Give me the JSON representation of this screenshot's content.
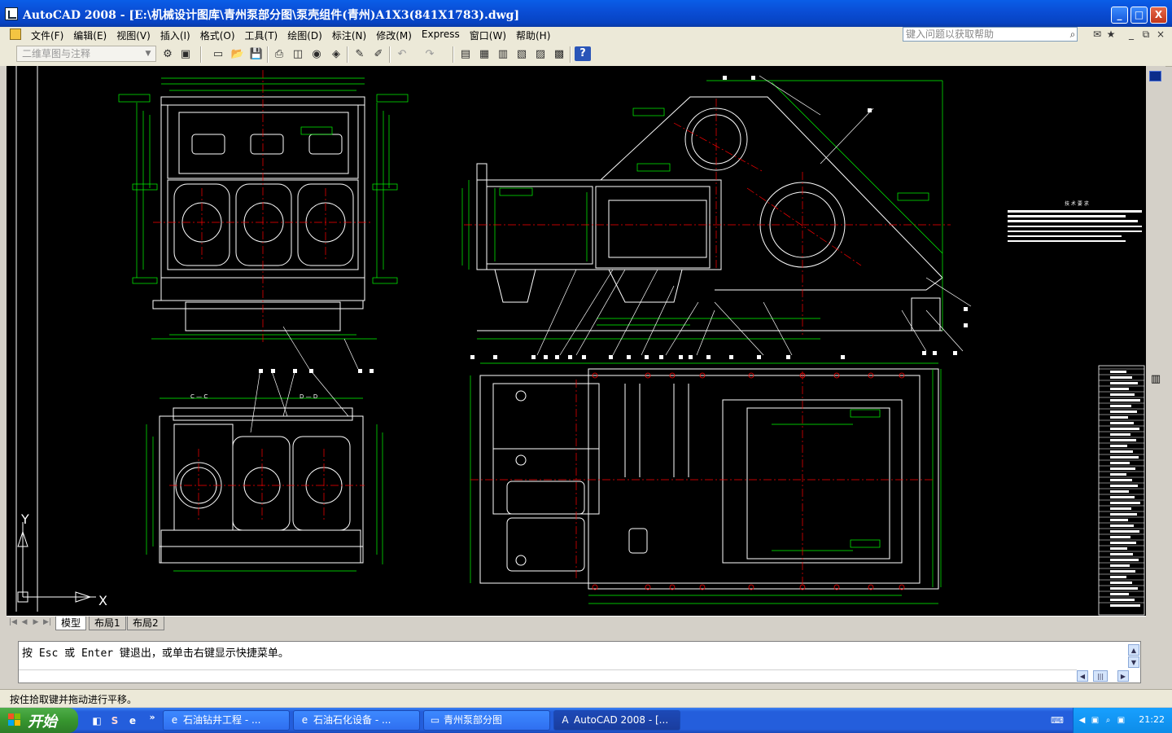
{
  "window": {
    "title": "AutoCAD 2008 - [E:\\机械设计图库\\青州泵部分图\\泵壳组件(青州)A1X3(841X1783).dwg]",
    "min_label": "_",
    "max_label": "□",
    "close_label": "X"
  },
  "menubar": {
    "items": [
      "文件(F)",
      "编辑(E)",
      "视图(V)",
      "插入(I)",
      "格式(O)",
      "工具(T)",
      "绘图(D)",
      "标注(N)",
      "修改(M)",
      "Express",
      "窗口(W)",
      "帮助(H)"
    ],
    "help_placeholder": "键入问题以获取帮助",
    "doc_min": "_",
    "doc_restore": "⧉",
    "doc_close": "×"
  },
  "toolbar": {
    "workspace": "二维草图与注释",
    "icons": [
      "gear-icon",
      "toolpalette-icon",
      "new-icon",
      "open-icon",
      "save-icon",
      "print-icon",
      "preview-icon",
      "publish-icon",
      "plot3d-icon",
      "brush-icon",
      "matchprop-icon",
      "undo-icon",
      "redo-icon",
      "layers-icon",
      "properties-icon",
      "designcenter-icon",
      "sheetset-icon",
      "markup-icon",
      "calculator-icon",
      "help-icon"
    ]
  },
  "drawing": {
    "background": "#000000",
    "ucs_x": "X",
    "ucs_y": "Y",
    "tech_req_title": "技 术 要 求",
    "section_cc": "C — C",
    "section_dd": "D — D"
  },
  "tabs": {
    "items": [
      "模型",
      "布局1",
      "布局2"
    ],
    "active": "模型"
  },
  "command": {
    "text": "按 Esc 或 Enter 键退出，或单击右键显示快捷菜单。"
  },
  "status": {
    "text": "按住拾取键并拖动进行平移。"
  },
  "taskbar": {
    "start": "开始",
    "tasks": [
      "石油钻井工程 - ...",
      "石油石化设备 - ...",
      "青州泵部分图",
      "AutoCAD 2008 - [..."
    ],
    "clock": "21:22"
  },
  "colors": {
    "geometry_white": "#ffffff",
    "dimension_green": "#00ff00",
    "centerline_red": "#ff0000",
    "xp_blue": "#245edc"
  }
}
